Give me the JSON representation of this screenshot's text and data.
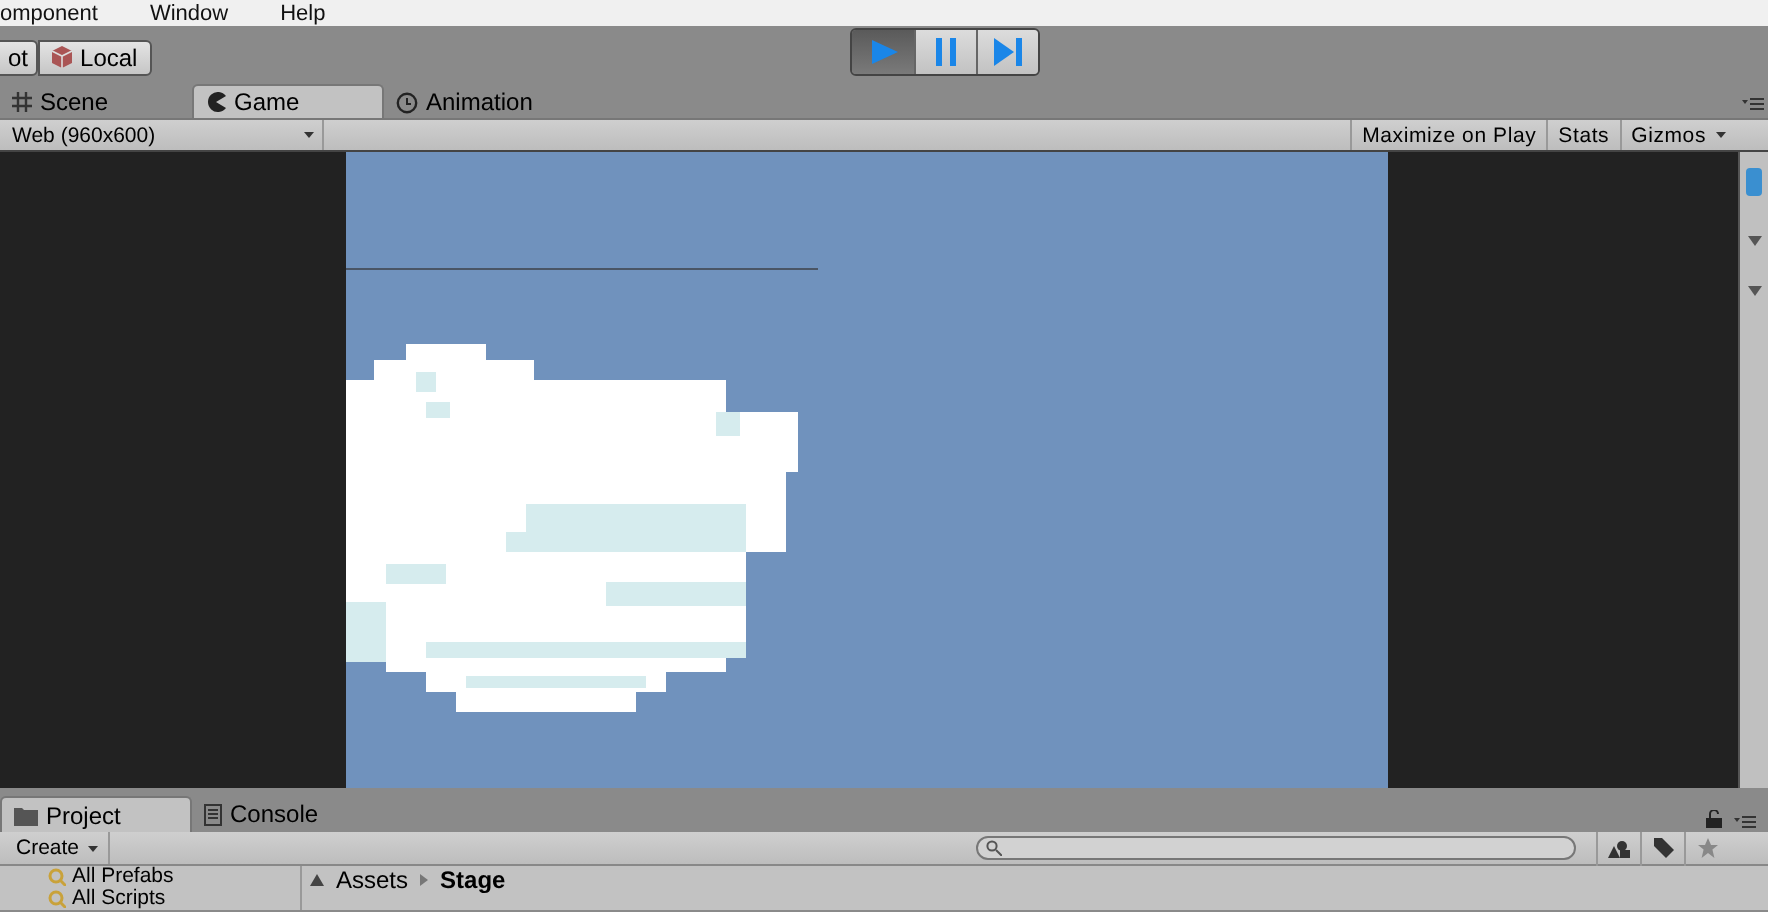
{
  "menu": [
    "omponent",
    "Window",
    "Help"
  ],
  "toolbar": {
    "handle_buttons": [
      {
        "label": "ot",
        "kind": "plain"
      },
      {
        "label": "Local",
        "kind": "cube"
      }
    ],
    "play_controls": [
      {
        "kind": "play",
        "selected": true
      },
      {
        "kind": "pause",
        "selected": false
      },
      {
        "kind": "step",
        "selected": false
      }
    ]
  },
  "tabs": [
    {
      "label": "Scene",
      "kind": "grid",
      "selected": false
    },
    {
      "label": "Game",
      "kind": "pacman",
      "selected": true
    },
    {
      "label": "Animation",
      "kind": "clock",
      "selected": false
    }
  ],
  "game_toolbar": {
    "resolution": "Web (960x600)",
    "buttons": [
      {
        "label": "Maximize on Play",
        "kind": "toggle"
      },
      {
        "label": "Stats",
        "kind": "toggle"
      },
      {
        "label": "Gizmos",
        "kind": "dropdown"
      }
    ]
  },
  "bottom_tabs": [
    {
      "label": "Project",
      "kind": "folder",
      "selected": true
    },
    {
      "label": "Console",
      "kind": "doc",
      "selected": false
    }
  ],
  "project": {
    "create": "Create",
    "tree": [
      "All Prefabs",
      "All Scripts"
    ],
    "breadcrumb": [
      "Assets",
      "Stage"
    ]
  }
}
